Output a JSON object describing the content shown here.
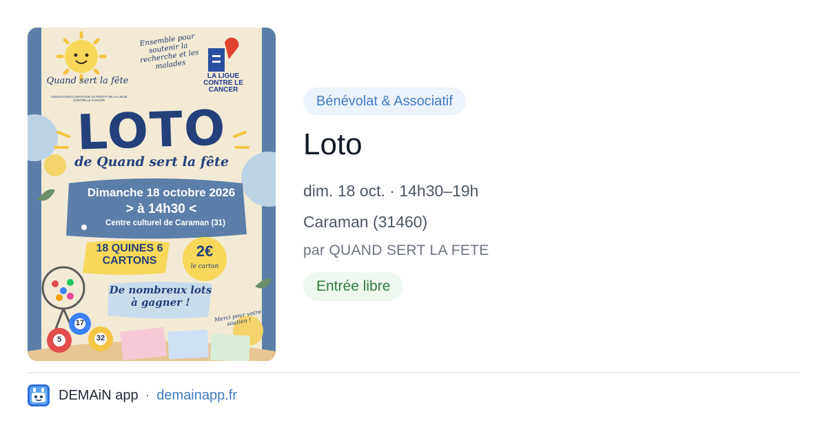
{
  "poster": {
    "association_name": "Quand sert la fête",
    "association_sub": "ASSOCIATION CARITATIVE AU PROFIT DE LA LIGUE CONTRE LE CANCER",
    "tagline": "Ensemble pour soutenir la recherche et les malades",
    "partner": "LA LIGUE CONTRE LE CANCER",
    "title": "LOTO",
    "subtitle": "de Quand sert la fête",
    "date": "Dimanche 18 octobre 2026",
    "time": "> à 14h30 <",
    "place": "Centre culturel de Caraman (31)",
    "quines": "18 QUINES 6 CARTONS",
    "price": "2€",
    "price_unit": "le carton",
    "prizes": "De nombreux lots à gagner !",
    "thanks": "Merci pour votre soutien !",
    "balls": [
      "5",
      "17",
      "32"
    ]
  },
  "event": {
    "category": "Bénévolat & Associatif",
    "title": "Loto",
    "datetime": "dim. 18 oct. · 14h30–19h",
    "location": "Caraman (31460)",
    "organizer": "par QUAND SERT LA FETE",
    "price": "Entrée libre"
  },
  "footer": {
    "app_name": "DEMAiN app",
    "separator": "·",
    "link": "demainapp.fr"
  }
}
